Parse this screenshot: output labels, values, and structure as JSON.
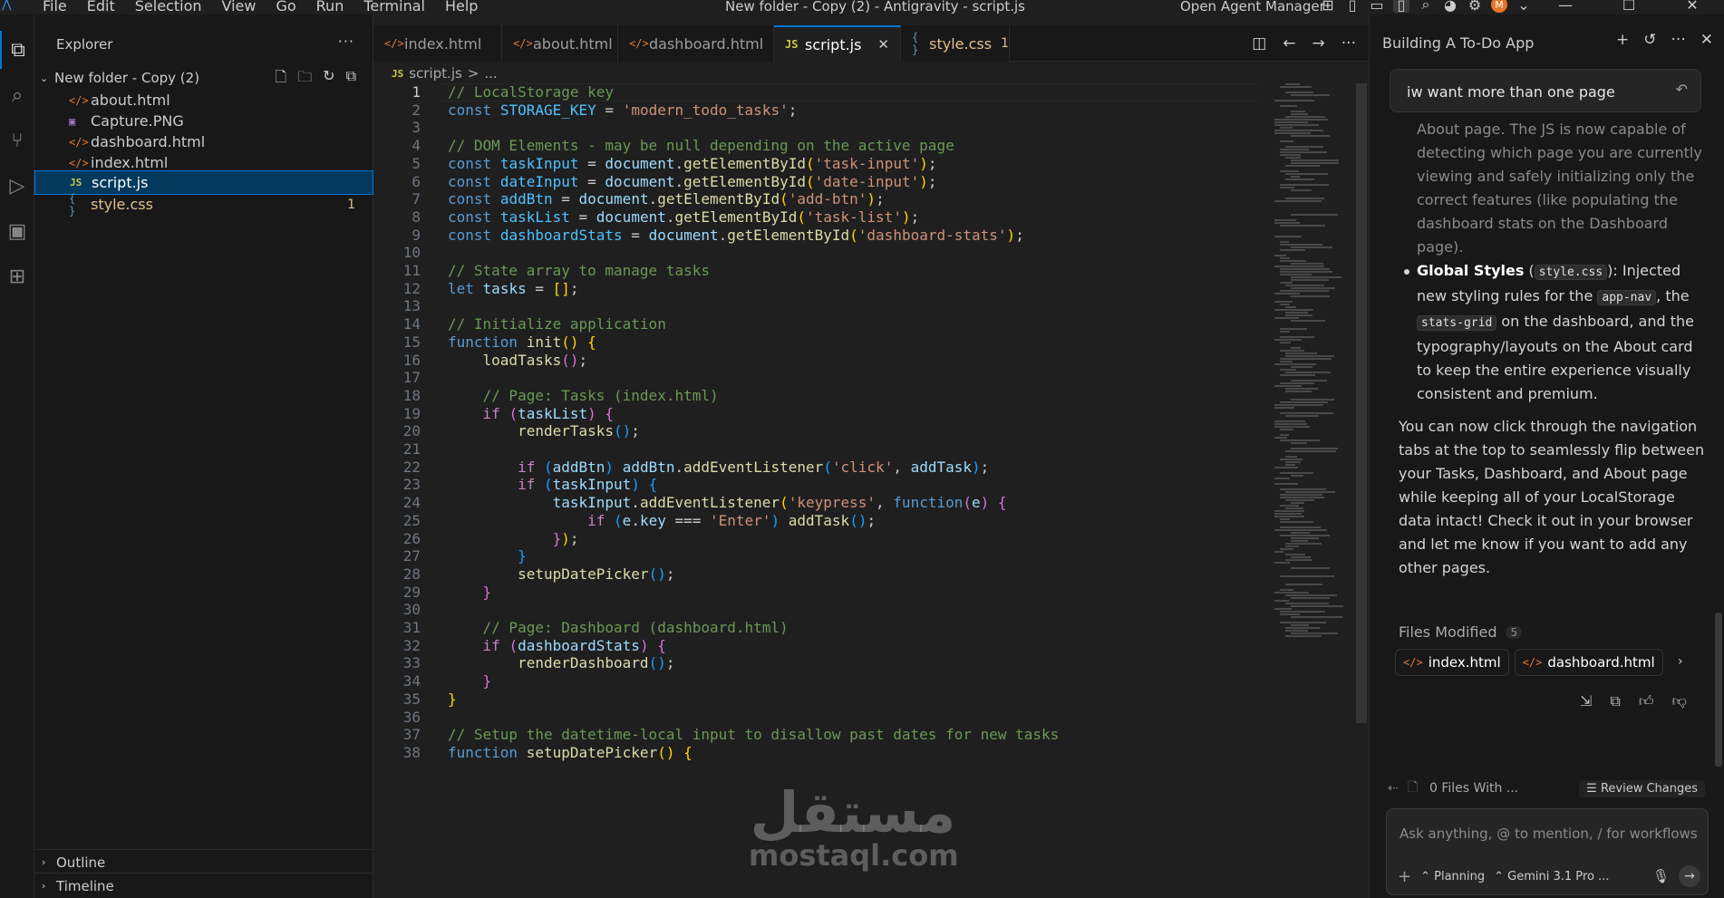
{
  "titlebar": {
    "menu": [
      "File",
      "Edit",
      "Selection",
      "View",
      "Go",
      "Run",
      "Terminal",
      "Help"
    ],
    "window_title": "New folder - Copy (2) - Antigravity - script.js",
    "agent_manager": "Open Agent Manager",
    "avatar_letter": "M"
  },
  "sidebar": {
    "title": "Explorer",
    "more": "···",
    "folder": "New folder - Copy (2)",
    "files": [
      {
        "icon": "</>",
        "name": "about.html"
      },
      {
        "icon": "▣",
        "name": "Capture.PNG"
      },
      {
        "icon": "</>",
        "name": "dashboard.html"
      },
      {
        "icon": "</>",
        "name": "index.html"
      },
      {
        "icon": "JS",
        "name": "script.js"
      },
      {
        "icon": "{ }",
        "name": "style.css",
        "badge": "1"
      }
    ],
    "outline": "Outline",
    "timeline": "Timeline"
  },
  "tabs": [
    {
      "icon": "</>",
      "label": "index.html"
    },
    {
      "icon": "</>",
      "label": "about.html"
    },
    {
      "icon": "</>",
      "label": "dashboard.html"
    },
    {
      "icon": "JS",
      "label": "script.js",
      "close": "✕"
    },
    {
      "icon": "{ }",
      "label": "style.css",
      "badge": "1"
    }
  ],
  "breadcrumb": {
    "icon": "JS",
    "file": "script.js",
    "sep": ">",
    "rest": "..."
  },
  "code_lines": [
    {
      "n": "1",
      "html": "<span class='c-com'>// LocalStorage key</span>"
    },
    {
      "n": "2",
      "html": "<span class='c-kw'>const</span> <span class='c-var'>STORAGE_KEY</span> = <span class='c-str'>'modern_todo_tasks'</span>;"
    },
    {
      "n": "3",
      "html": ""
    },
    {
      "n": "4",
      "html": "<span class='c-com'>// DOM Elements - may be null depending on the active page</span>"
    },
    {
      "n": "5",
      "html": "<span class='c-kw'>const</span> <span class='c-var'>taskInput</span> = <span class='c-prop'>document</span>.<span class='c-fn'>getElementById</span><span class='c-p1'>(</span><span class='c-str'>'task-input'</span><span class='c-p1'>)</span>;"
    },
    {
      "n": "6",
      "html": "<span class='c-kw'>const</span> <span class='c-var'>dateInput</span> = <span class='c-prop'>document</span>.<span class='c-fn'>getElementById</span><span class='c-p1'>(</span><span class='c-str'>'date-input'</span><span class='c-p1'>)</span>;"
    },
    {
      "n": "7",
      "html": "<span class='c-kw'>const</span> <span class='c-var'>addBtn</span> = <span class='c-prop'>document</span>.<span class='c-fn'>getElementById</span><span class='c-p1'>(</span><span class='c-str'>'add-btn'</span><span class='c-p1'>)</span>;"
    },
    {
      "n": "8",
      "html": "<span class='c-kw'>const</span> <span class='c-var'>taskList</span> = <span class='c-prop'>document</span>.<span class='c-fn'>getElementById</span><span class='c-p1'>(</span><span class='c-str'>'task-list'</span><span class='c-p1'>)</span>;"
    },
    {
      "n": "9",
      "html": "<span class='c-kw'>const</span> <span class='c-var'>dashboardStats</span> = <span class='c-prop'>document</span>.<span class='c-fn'>getElementById</span><span class='c-p1'>(</span><span class='c-str'>'dashboard-stats'</span><span class='c-p1'>)</span>;"
    },
    {
      "n": "10",
      "html": ""
    },
    {
      "n": "11",
      "html": "<span class='c-com'>// State array to manage tasks</span>"
    },
    {
      "n": "12",
      "html": "<span class='c-kw'>let</span> <span class='c-prop'>tasks</span> = <span class='c-p1'>[]</span>;"
    },
    {
      "n": "13",
      "html": ""
    },
    {
      "n": "14",
      "html": "<span class='c-com'>// Initialize application</span>"
    },
    {
      "n": "15",
      "html": "<span class='c-kw'>function</span> <span class='c-fn'>init</span><span class='c-p1'>()</span> <span class='c-p1'>{</span>"
    },
    {
      "n": "16",
      "html": "    <span class='c-fn'>loadTasks</span><span class='c-p2'>()</span>;"
    },
    {
      "n": "17",
      "html": ""
    },
    {
      "n": "18",
      "html": "    <span class='c-com'>// Page: Tasks (index.html)</span>"
    },
    {
      "n": "19",
      "html": "    <span class='c-ctl'>if</span> <span class='c-p2'>(</span><span class='c-prop'>taskList</span><span class='c-p2'>)</span> <span class='c-p2'>{</span>"
    },
    {
      "n": "20",
      "html": "        <span class='c-fn'>renderTasks</span><span class='c-p3'>()</span>;"
    },
    {
      "n": "21",
      "html": ""
    },
    {
      "n": "22",
      "html": "        <span class='c-ctl'>if</span> <span class='c-p3'>(</span><span class='c-prop'>addBtn</span><span class='c-p3'>)</span> <span class='c-prop'>addBtn</span>.<span class='c-fn'>addEventListener</span><span class='c-p3'>(</span><span class='c-str'>'click'</span>, <span class='c-prop'>addTask</span><span class='c-p3'>)</span>;"
    },
    {
      "n": "23",
      "html": "        <span class='c-ctl'>if</span> <span class='c-p3'>(</span><span class='c-prop'>taskInput</span><span class='c-p3'>)</span> <span class='c-p3'>{</span>"
    },
    {
      "n": "24",
      "html": "            <span class='c-prop'>taskInput</span>.<span class='c-fn'>addEventListener</span><span class='c-p1'>(</span><span class='c-str'>'keypress'</span>, <span class='c-kw'>function</span><span class='c-p2'>(</span><span class='c-prop'>e</span><span class='c-p2'>)</span> <span class='c-p2'>{</span>"
    },
    {
      "n": "25",
      "html": "                <span class='c-ctl'>if</span> <span class='c-p3'>(</span><span class='c-prop'>e</span>.<span class='c-prop'>key</span> === <span class='c-str'>'Enter'</span><span class='c-p3'>)</span> <span class='c-fn'>addTask</span><span class='c-p3'>()</span>;"
    },
    {
      "n": "26",
      "html": "            <span class='c-p2'>}</span><span class='c-p1'>)</span>;"
    },
    {
      "n": "27",
      "html": "        <span class='c-p3'>}</span>"
    },
    {
      "n": "28",
      "html": "        <span class='c-fn'>setupDatePicker</span><span class='c-p3'>()</span>;"
    },
    {
      "n": "29",
      "html": "    <span class='c-p2'>}</span>"
    },
    {
      "n": "30",
      "html": ""
    },
    {
      "n": "31",
      "html": "    <span class='c-com'>// Page: Dashboard (dashboard.html)</span>"
    },
    {
      "n": "32",
      "html": "    <span class='c-ctl'>if</span> <span class='c-p2'>(</span><span class='c-prop'>dashboardStats</span><span class='c-p2'>)</span> <span class='c-p2'>{</span>"
    },
    {
      "n": "33",
      "html": "        <span class='c-fn'>renderDashboard</span><span class='c-p3'>()</span>;"
    },
    {
      "n": "34",
      "html": "    <span class='c-p2'>}</span>"
    },
    {
      "n": "35",
      "html": "<span class='c-p1'>}</span>"
    },
    {
      "n": "36",
      "html": ""
    },
    {
      "n": "37",
      "html": "<span class='c-com'>// Setup the datetime-local input to disallow past dates for new tasks</span>"
    },
    {
      "n": "38",
      "html": "<span class='c-kw'>function</span> <span class='c-fn'>setupDatePicker</span><span class='c-p1'>()</span> <span class='c-p1'>{</span>"
    }
  ],
  "agent": {
    "title": "Building A To-Do App",
    "query": "iw want more than one page",
    "para1": "About page. The JS is now capable of detecting which page you are currently viewing and safely initializing only the correct features (like populating the dashboard stats on the Dashboard page).",
    "bullet_bold": "Global Styles",
    "bullet_code1": "style.css",
    "bullet_text1": "): Injected new styling rules for the",
    "bullet_code2": "app-nav",
    "bullet_text2": ", the",
    "bullet_code3": "stats-grid",
    "bullet_text3": "on the dashboard, and the typography/layouts on the About card to keep the entire experience visually consistent and premium.",
    "para2": "You can now click through the navigation tabs at the top to seamlessly flip between your Tasks, Dashboard, and About page while keeping all of your LocalStorage data intact! Check it out in your browser and let me know if you want to add any other pages.",
    "files_modified": "Files Modified",
    "files_count": "5",
    "chips": [
      "index.html",
      "dashboard.html"
    ],
    "files_with": "0 Files With ...",
    "review": "Review Changes",
    "input_placeholder": "Ask anything, @ to mention, / for workflows",
    "mode": "Planning",
    "model": "Gemini 3.1 Pro ..."
  },
  "watermark": {
    "arabic": "مستقل",
    "latin": "mostaql.com"
  }
}
